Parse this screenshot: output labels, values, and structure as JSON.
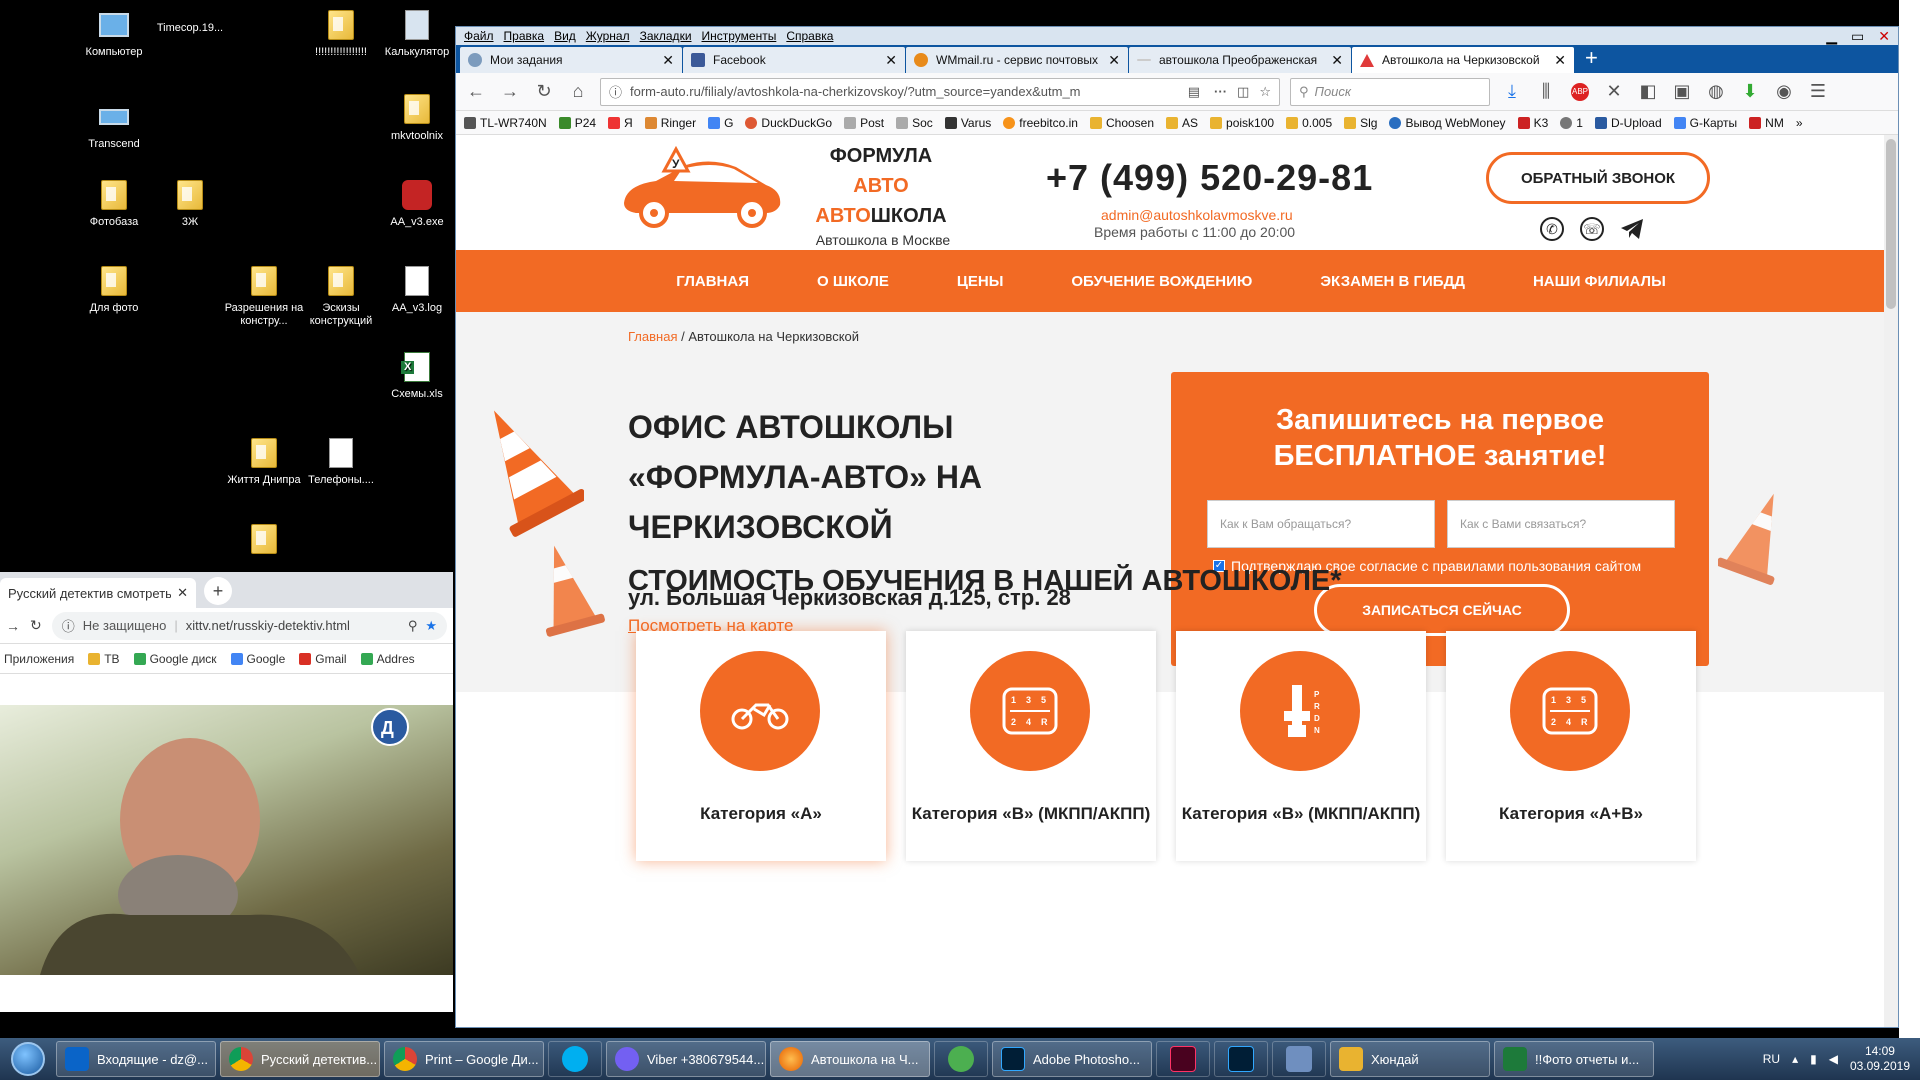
{
  "desktop": {
    "icons": [
      {
        "label": "Компьютер"
      },
      {
        "label": "Timecop.19..."
      },
      {
        "label": "!!!!!!!!!!!!!!!!!"
      },
      {
        "label": "Калькулятор"
      },
      {
        "label": "Transcend"
      },
      {
        "label": "mkvtoolnix"
      },
      {
        "label": "Фотобаза"
      },
      {
        "label": "3Ж"
      },
      {
        "label": "AA_v3.exe"
      },
      {
        "label": "Для фото"
      },
      {
        "label": "Разрешения на констру..."
      },
      {
        "label": "Эскизы конструкций"
      },
      {
        "label": "AA_v3.log"
      },
      {
        "label": "Схемы.xls"
      },
      {
        "label": "Життя Днипра"
      },
      {
        "label": "Телефоны...."
      }
    ]
  },
  "firefox": {
    "menu": [
      "Файл",
      "Правка",
      "Вид",
      "Журнал",
      "Закладки",
      "Инструменты",
      "Справка"
    ],
    "tabs": [
      {
        "title": "Мои задания"
      },
      {
        "title": "Facebook"
      },
      {
        "title": "WMmail.ru - сервис почтовых"
      },
      {
        "title": "автошкола Преображенская"
      },
      {
        "title": "Автошкола на Черкизовской"
      }
    ],
    "url": "form-auto.ru/filialy/avtoshkola-na-cherkizovskoy/?utm_source=yandex&utm_m",
    "search_placeholder": "Поиск",
    "bookmarks": [
      "TL-WR740N",
      "P24",
      "Я",
      "Ringer",
      "G",
      "DuckDuckGo",
      "Post",
      "Soc",
      "Varus",
      "freebitco.in",
      "Choosen",
      "AS",
      "poisk100",
      "0.005",
      "Slg",
      "Вывод WebMoney",
      "K3",
      "1",
      "D-Upload",
      "G-Карты",
      "NM"
    ]
  },
  "site": {
    "logo": {
      "line1": "ФОРМУЛА",
      "line2": "АВТО",
      "line3a": "АВТО",
      "line3b": "ШКОЛА",
      "sub": "Автошкола в Москве"
    },
    "phone": "+7 (499) 520-29-81",
    "email": "admin@autoshkolavmoskve.ru",
    "hours": "Время работы с 11:00 до 20:00",
    "callback": "ОБРАТНЫЙ ЗВОНОК",
    "nav": [
      "ГЛАВНАЯ",
      "О ШКОЛЕ",
      "ЦЕНЫ",
      "ОБУЧЕНИЕ ВОЖДЕНИЮ",
      "ЭКЗАМЕН В ГИБДД",
      "НАШИ ФИЛИАЛЫ"
    ],
    "breadcrumb": {
      "home": "Главная",
      "sep": " / ",
      "current": "Автошкола на Черкизовской"
    },
    "hero_title": "ОФИС АВТОШКОЛЫ «ФОРМУЛА-АВТО» НА ЧЕРКИЗОВСКОЙ",
    "address": "ул. Большая Черкизовская д.125, стр. 28",
    "map_link": "Посмотреть на карте",
    "form": {
      "title1": "Запишитесь на первое",
      "title2": "БЕСПЛАТНОЕ занятие!",
      "name_placeholder": "Как к Вам обращаться?",
      "contact_placeholder": "Как с Вами связаться?",
      "agree": "Подтверждаю свое согласие с правилами пользования сайтом",
      "submit": "ЗАПИСАТЬСЯ СЕЙЧАС"
    },
    "prices_title": "СТОИМОСТЬ ОБУЧЕНИЯ В НАШЕЙ АВТОШКОЛЕ*",
    "cards": [
      {
        "label": "Категория «А»"
      },
      {
        "label": "Категория «В» (МКПП/АКПП)"
      },
      {
        "label": "Категория «В» (МКПП/АКПП)"
      },
      {
        "label": "Категория «А+В»"
      }
    ]
  },
  "chrome": {
    "tab": "Русский детектив смотреть",
    "insecure": "Не защищено",
    "url": "xittv.net/russkiy-detektiv.html",
    "bookmarks": [
      "Приложения",
      "ТВ",
      "Google диск",
      "Google",
      "Gmail",
      "Addres"
    ]
  },
  "taskbar": {
    "items": [
      "Входящие - dz@...",
      "Русский детектив...",
      "Print – Google Ди...",
      "Viber +380679544...",
      "Автошкола на Ч...",
      "Adobe Photosho...",
      "Хюндай",
      "!!Фото отчеты и..."
    ],
    "lang": "RU",
    "time": "14:09",
    "date": "03.09.2019"
  },
  "colors": {
    "accent": "#f26a24",
    "firefox_tabbar": "#0d55a0",
    "taskbar": "#2a4466"
  }
}
